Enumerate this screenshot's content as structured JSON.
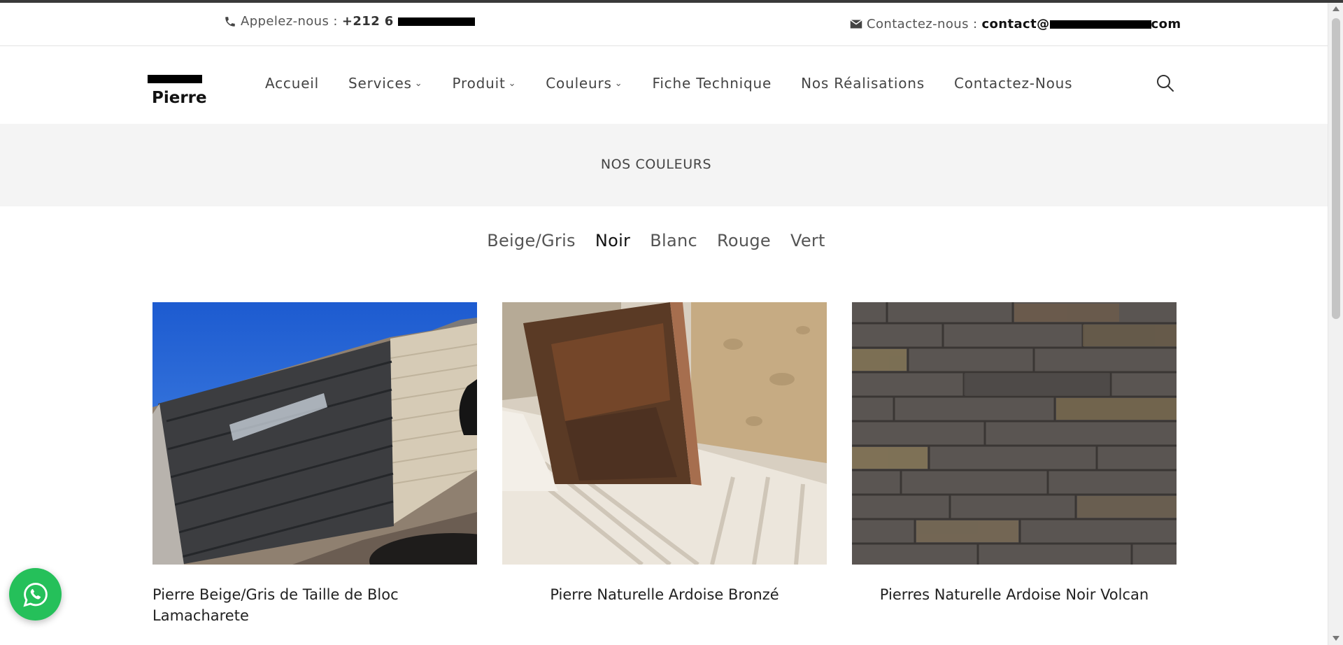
{
  "topbar": {
    "phone_label": "Appelez-nous :",
    "phone_prefix": "+212 6",
    "email_label": "Contactez-nous :",
    "email_prefix": "contact@",
    "email_suffix": "com"
  },
  "brand": {
    "name": "Pierre"
  },
  "nav": {
    "items": [
      {
        "label": "Accueil",
        "dropdown": false
      },
      {
        "label": "Services",
        "dropdown": true
      },
      {
        "label": "Produit",
        "dropdown": true
      },
      {
        "label": "Couleurs",
        "dropdown": true
      },
      {
        "label": "Fiche Technique",
        "dropdown": false
      },
      {
        "label": "Nos Réalisations",
        "dropdown": false
      },
      {
        "label": "Contactez-Nous",
        "dropdown": false
      }
    ],
    "search_icon": "search-icon"
  },
  "banner": {
    "title": "NOS COULEURS"
  },
  "filters": {
    "items": [
      "Beige/Gris",
      "Noir",
      "Blanc",
      "Rouge",
      "Vert"
    ],
    "active": "Noir"
  },
  "products": [
    {
      "title": "Pierre Beige/Gris de Taille de Bloc Lamacharete"
    },
    {
      "title": "Pierre Naturelle Ardoise Bronzé"
    },
    {
      "title": "Pierres Naturelle Ardoise Noir Volcan"
    }
  ],
  "colors": {
    "whatsapp": "#25c05a",
    "banner_bg": "#f4f4f4",
    "top_border": "#3a3a3a"
  }
}
